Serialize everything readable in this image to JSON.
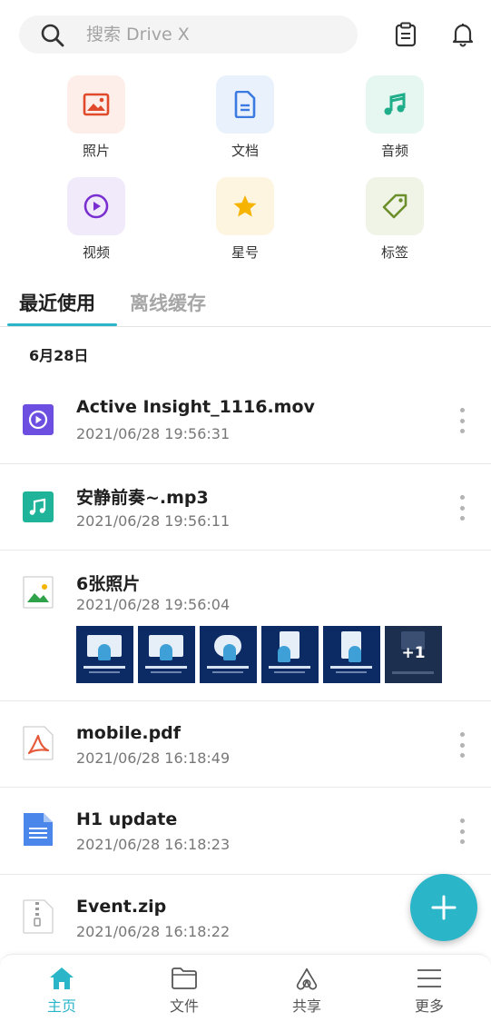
{
  "search": {
    "placeholder": "搜索 Drive X"
  },
  "categories": [
    {
      "label": "照片",
      "icon": "photo-icon",
      "color": "#e04a2a",
      "bg": "#fdeeea"
    },
    {
      "label": "文档",
      "icon": "document-icon",
      "color": "#3b7ae0",
      "bg": "#e9f1fd"
    },
    {
      "label": "音频",
      "icon": "music-icon",
      "color": "#1fae8a",
      "bg": "#e6f6f1"
    },
    {
      "label": "视频",
      "icon": "play-icon",
      "color": "#7a2fd0",
      "bg": "#f1eafb"
    },
    {
      "label": "星号",
      "icon": "star-icon",
      "color": "#f6b400",
      "bg": "#fef5e1"
    },
    {
      "label": "标签",
      "icon": "tag-icon",
      "color": "#6b8f2a",
      "bg": "#eff4e6"
    }
  ],
  "tabs": [
    {
      "label": "最近使用",
      "active": true
    },
    {
      "label": "离线缓存",
      "active": false
    }
  ],
  "date_header": "6月28日",
  "files": [
    {
      "name": "Active Insight_1116.mov",
      "date": "2021/06/28 19:56:31",
      "icon": "video-file-icon"
    },
    {
      "name": "安静前奏~.mp3",
      "date": "2021/06/28 19:56:11",
      "icon": "audio-file-icon"
    },
    {
      "name": "6张照片",
      "date": "2021/06/28 19:56:04",
      "icon": "image-file-icon",
      "extra_count": "+1"
    },
    {
      "name": "mobile.pdf",
      "date": "2021/06/28 16:18:49",
      "icon": "pdf-file-icon"
    },
    {
      "name": "H1 update",
      "date": "2021/06/28 16:18:23",
      "icon": "doc-file-icon"
    },
    {
      "name": "Event.zip",
      "date": "2021/06/28 16:18:22",
      "icon": "zip-file-icon"
    }
  ],
  "nav": [
    {
      "label": "主页",
      "icon": "home-icon",
      "active": true
    },
    {
      "label": "文件",
      "icon": "folder-icon",
      "active": false
    },
    {
      "label": "共享",
      "icon": "share-icon",
      "active": false
    },
    {
      "label": "更多",
      "icon": "menu-icon",
      "active": false
    }
  ],
  "colors": {
    "accent": "#2bb5c9"
  }
}
